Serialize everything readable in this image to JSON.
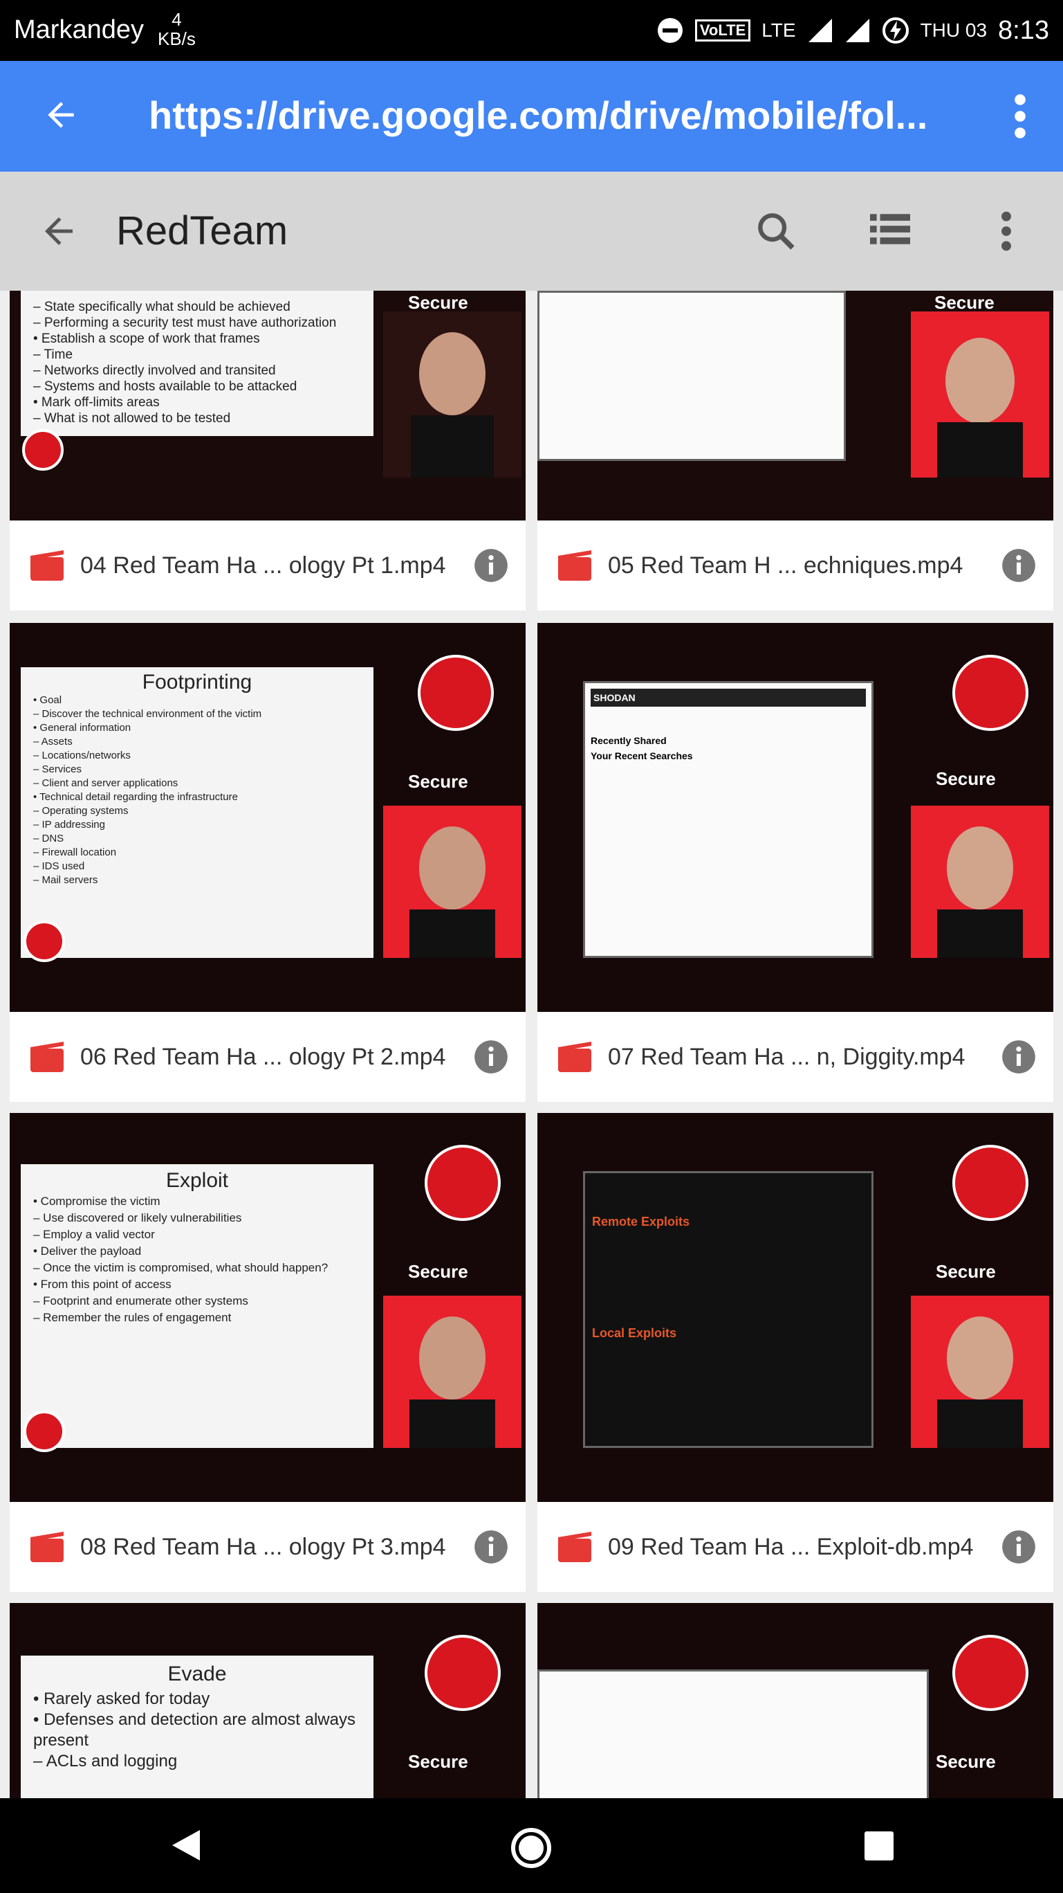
{
  "status_bar": {
    "carrier": "Markandey",
    "speed_value": "4",
    "speed_unit": "KB/s",
    "network_badge": "VoLTE",
    "network_type": "LTE",
    "day": "THU 03",
    "time": "8:13"
  },
  "browser": {
    "url": "https://drive.google.com/drive/mobile/fol...",
    "back_icon": "arrow-back-icon",
    "menu_icon": "more-vert-icon"
  },
  "app_bar": {
    "title": "RedTeam",
    "icons": [
      "arrow-back-icon",
      "search-icon",
      "list-view-icon",
      "more-vert-icon"
    ]
  },
  "thumbnail_text": {
    "logo_word": "Secure",
    "t04_lines": [
      "– State specifically what should be achieved",
      "– Performing a security test must have authorization",
      "• Establish a scope of work that frames",
      "– Time",
      "– Networks directly involved and transited",
      "– Systems and hosts available to be attacked",
      "• Mark off-limits areas",
      "– What is not allowed to be tested"
    ],
    "t06_title": "Footprinting",
    "t06_lines": [
      "• Goal",
      "– Discover the technical environment of the victim",
      "• General information",
      "– Assets",
      "– Locations/networks",
      "– Services",
      "– Client and server applications",
      "• Technical detail regarding the infrastructure",
      "– Operating systems",
      "– IP addressing",
      "– DNS",
      "– Firewall location",
      "– IDS used",
      "– Mail servers"
    ],
    "t08_title": "Exploit",
    "t08_lines": [
      "• Compromise the victim",
      "– Use discovered or likely vulnerabilities",
      "– Employ a valid vector",
      "• Deliver the payload",
      "– Once the victim is compromised, what should happen?",
      "• From this point of access",
      "– Footprint and enumerate other systems",
      "– Remember the rules of engagement"
    ],
    "t09_heading1": "Remote Exploits",
    "t09_heading2": "Local Exploits",
    "t10_title": "Evade",
    "t10_lines": [
      "• Rarely asked for today",
      "• Defenses and detection are almost always present",
      "– ACLs and logging"
    ],
    "t07_app": "SHODAN",
    "t07_heading": "Recently Shared",
    "t07_heading2": "Your Recent Searches"
  },
  "files": [
    {
      "name": "04 Red Team Ha ... ology Pt 1.mp4"
    },
    {
      "name": "05 Red Team H ... echniques.mp4"
    },
    {
      "name": "06 Red Team Ha ... ology Pt 2.mp4"
    },
    {
      "name": "07 Red Team Ha ... n, Diggity.mp4"
    },
    {
      "name": "08 Red Team Ha ... ology Pt 3.mp4"
    },
    {
      "name": "09 Red Team Ha ... Exploit-db.mp4"
    }
  ],
  "colors": {
    "url_bar": "#4285f4",
    "app_bar": "#d6d6d6",
    "video_icon": "#e53935",
    "brand_red": "#e8212d"
  }
}
